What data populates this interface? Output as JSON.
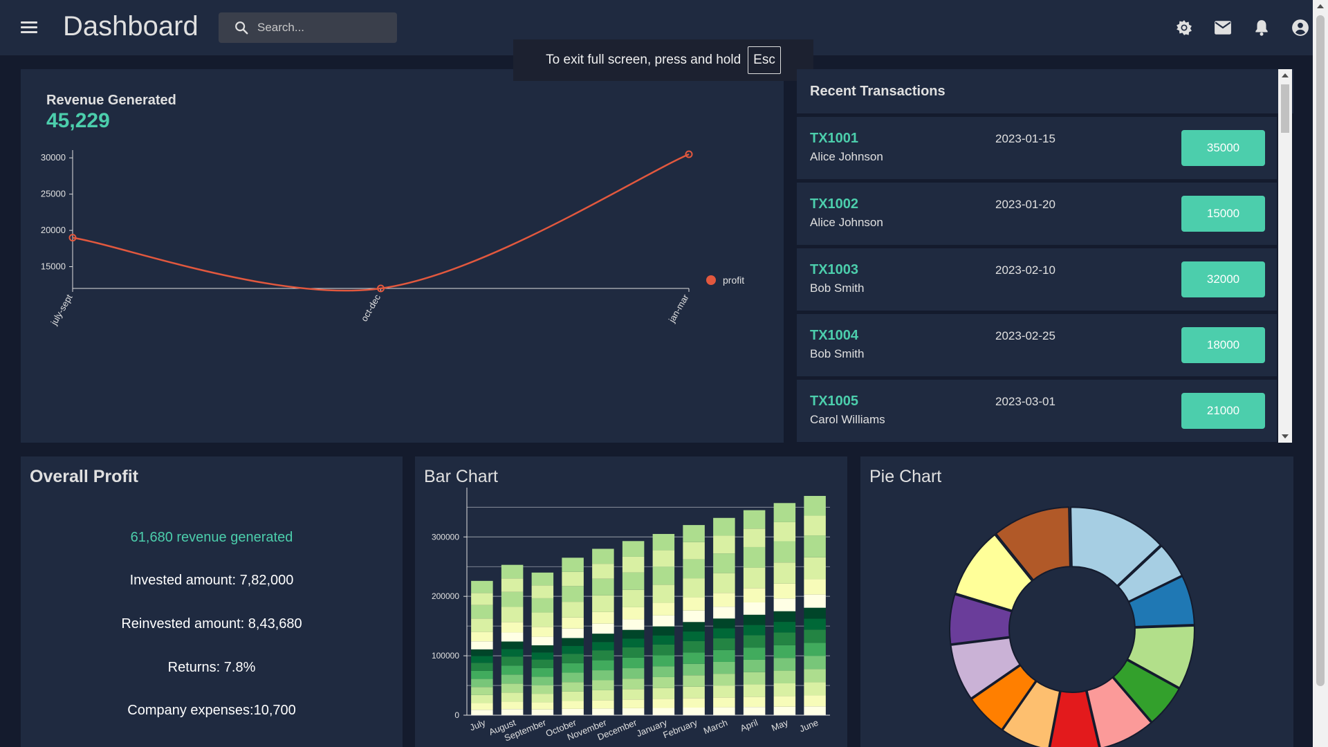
{
  "header": {
    "title": "Dashboard",
    "search_placeholder": "Search...",
    "icons": [
      "menu-icon",
      "light-mode-icon",
      "mail-icon",
      "notifications-icon",
      "account-icon"
    ]
  },
  "toast": {
    "text": "To exit full screen, press and hold",
    "key": "Esc"
  },
  "revenue": {
    "label": "Revenue Generated",
    "value": "45,229"
  },
  "transactions": {
    "title": "Recent Transactions",
    "items": [
      {
        "id": "TX1001",
        "user": "Alice Johnson",
        "date": "2023-01-15",
        "amount": "35000"
      },
      {
        "id": "TX1002",
        "user": "Alice Johnson",
        "date": "2023-01-20",
        "amount": "15000"
      },
      {
        "id": "TX1003",
        "user": "Bob Smith",
        "date": "2023-02-10",
        "amount": "32000"
      },
      {
        "id": "TX1004",
        "user": "Bob Smith",
        "date": "2023-02-25",
        "amount": "18000"
      },
      {
        "id": "TX1005",
        "user": "Carol Williams",
        "date": "2023-03-01",
        "amount": "21000"
      }
    ]
  },
  "profit": {
    "title": "Overall Profit",
    "revenue_text": "61,680 revenue generated",
    "invested": "Invested amount: 7,82,000",
    "reinvested": "Reinvested amount: 8,43,680",
    "returns": "Returns: 7.8%",
    "expenses": "Company expenses:10,700"
  },
  "bar_panel": {
    "title": "Bar Chart"
  },
  "pie_panel": {
    "title": "Pie Chart"
  },
  "colors": {
    "accent": "#4cceac",
    "line": "#e2583e",
    "panel": "#1f2a40",
    "background": "#141b2d"
  },
  "chart_data": [
    {
      "type": "line",
      "categories": [
        "july-sept",
        "oct-dec",
        "jan-mar"
      ],
      "series": [
        {
          "name": "profit",
          "values": [
            19000,
            12000,
            30500
          ]
        }
      ],
      "yticks": [
        15000,
        20000,
        25000,
        30000
      ],
      "ylim": [
        12000,
        30500
      ],
      "legend": "right",
      "color": "#e2583e"
    },
    {
      "type": "bar",
      "stacked": true,
      "categories": [
        "July",
        "August",
        "September",
        "October",
        "November",
        "December",
        "January",
        "February",
        "March",
        "April",
        "May",
        "June"
      ],
      "totals": [
        226000,
        253000,
        240000,
        265000,
        280000,
        293000,
        305000,
        320000,
        332000,
        345000,
        357000,
        369000
      ],
      "yticks": [
        0,
        100000,
        200000,
        300000
      ],
      "ylim": [
        0,
        369000
      ],
      "segment_colors": [
        "#f7fcb9",
        "#d9f0a3",
        "#addd8e",
        "#78c679",
        "#41ab5d",
        "#238443",
        "#006837",
        "#004529",
        "#ffffe5",
        "#f7fcb9",
        "#d9f0a3",
        "#addd8e"
      ]
    },
    {
      "type": "pie",
      "donut": true,
      "values": [
        14,
        5,
        7,
        9,
        6,
        8,
        7,
        7,
        6,
        8,
        7,
        10,
        11
      ],
      "colors": [
        "#a6cee3",
        "#a6cee3",
        "#1f78b4",
        "#b2df8a",
        "#33a02c",
        "#fb9a99",
        "#e31a1c",
        "#fdbf6f",
        "#ff7f00",
        "#cab2d6",
        "#6a3d9a",
        "#ffff99",
        "#b15928"
      ]
    }
  ]
}
